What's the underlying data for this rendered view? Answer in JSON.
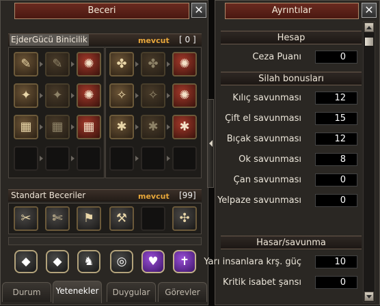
{
  "left": {
    "title": "Beceri",
    "close": "✕",
    "group1": {
      "name": "EjderGücü Binicilik",
      "available_label": "mevcut",
      "available_value": "[ 0 ]"
    },
    "group2": {
      "name": "Standart Beceriler",
      "available_label": "mevcut",
      "available_value": "[99]"
    },
    "grid_icons": [
      [
        "✎",
        "✎",
        "✺",
        "✤",
        "✤",
        "✺"
      ],
      [
        "✦",
        "✦",
        "✺",
        "✧",
        "✧",
        "✺"
      ],
      [
        "▦",
        "▦",
        "▦",
        "✱",
        "✱",
        "✱"
      ],
      [
        "",
        "",
        "",
        "",
        "",
        ""
      ]
    ],
    "standard_icons": [
      "✂",
      "✄",
      "⚑",
      "⚒",
      "",
      "✣"
    ],
    "bottom_icons": [
      "◆",
      "◆",
      "♞",
      "◎",
      "♥",
      "✝"
    ],
    "tabs": [
      "Durum",
      "Yetenekler",
      "Duygular",
      "Görevler"
    ],
    "active_tab": "Yetenekler"
  },
  "right": {
    "title": "Ayrıntılar",
    "close": "✕",
    "hesap_header": "Hesap",
    "ceza": {
      "label": "Ceza Puanı",
      "value": "0"
    },
    "silah_header": "Silah bonusları",
    "weapons": [
      {
        "label": "Kılıç savunması",
        "value": "12"
      },
      {
        "label": "Çift el savunması",
        "value": "15"
      },
      {
        "label": "Bıçak savunması",
        "value": "12"
      },
      {
        "label": "Ok savunması",
        "value": "8"
      },
      {
        "label": "Çan savunması",
        "value": "0"
      },
      {
        "label": "Yelpaze savunması",
        "value": "0"
      }
    ],
    "hasar_header": "Hasar/savunma",
    "damage": [
      {
        "label": "Yarı insanlara krş. güç",
        "value": "10"
      },
      {
        "label": "Kritik isabet şansı",
        "value": "0"
      }
    ]
  }
}
